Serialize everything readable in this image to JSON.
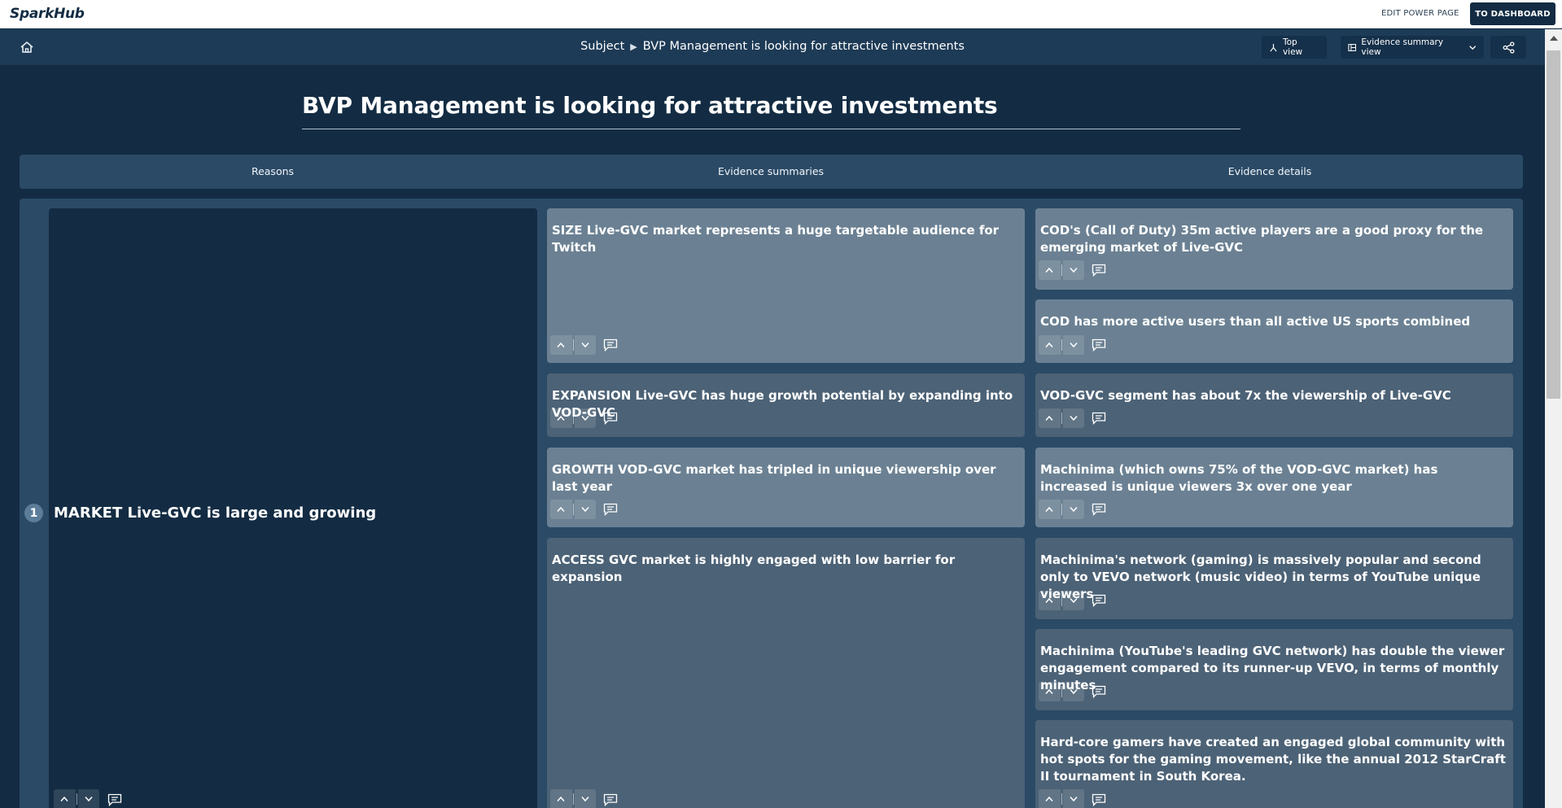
{
  "app": {
    "brand": "SparkHub",
    "edit_link": "EDIT POWER PAGE",
    "dashboard_button": "TO DASHBOARD"
  },
  "toolbar": {
    "breadcrumb_root": "Subject",
    "breadcrumb_current": "BVP Management is looking for attractive investments",
    "top_view_label": "Top view",
    "summary_view_label": "Evidence summary view"
  },
  "page": {
    "title": "BVP Management is looking for attractive investments"
  },
  "columns": {
    "reasons": "Reasons",
    "summaries": "Evidence summaries",
    "details": "Evidence details"
  },
  "reason": {
    "number": "1",
    "text": "MARKET Live-GVC is large and growing"
  },
  "summaries": [
    {
      "text": "SIZE Live-GVC market represents a huge targetable audience for Twitch"
    },
    {
      "text": "EXPANSION Live-GVC has huge growth potential by expanding into VOD-GVC"
    },
    {
      "text": "GROWTH VOD-GVC market has tripled in unique viewership over last year"
    },
    {
      "text": "ACCESS GVC market is highly engaged with low barrier for expansion"
    }
  ],
  "details": [
    {
      "text": "COD's (Call of Duty) 35m active players are a good proxy for the emerging market of Live-GVC"
    },
    {
      "text": "COD has more active users than all active US sports combined"
    },
    {
      "text": "VOD-GVC segment has about 7x the viewership of Live-GVC"
    },
    {
      "text": "Machinima (which owns 75% of the VOD-GVC market) has increased is unique viewers 3x over one year"
    },
    {
      "text": "Machinima's network (gaming) is massively popular and second only to VEVO network (music video) in terms of YouTube unique viewers"
    },
    {
      "text": "Machinima (YouTube's leading GVC network) has double the viewer engagement compared to its runner-up VEVO, in terms of monthly minutes"
    },
    {
      "text": "Hard-core gamers have created an engaged global community with hot spots for the gaming movement, like the annual 2012 StarCraft II tournament in South Korea."
    }
  ],
  "icons": {
    "home": "home-icon",
    "top_view": "hierarchy-icon",
    "summary_view": "layout-icon",
    "dropdown": "chevron-down-icon",
    "share": "share-icon",
    "upvote": "chevron-up-icon",
    "downvote": "chevron-down-icon",
    "comment": "comment-icon"
  },
  "colors": {
    "navy": "#132c43",
    "panel": "#2b4a66",
    "card_light": "#6b8193",
    "card_mid": "#4c6276"
  }
}
